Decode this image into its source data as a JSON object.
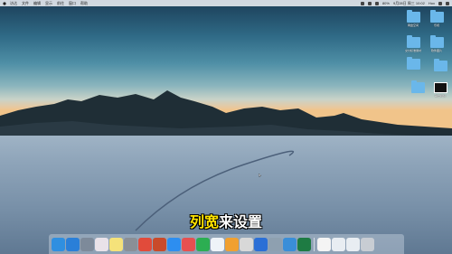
{
  "menubar": {
    "items": [
      "访达",
      "文件",
      "编辑",
      "显示",
      "前往",
      "窗口",
      "帮助"
    ],
    "status": [
      "80%",
      "9月28日 周三 10:02",
      "Hox"
    ]
  },
  "desktop_icons": [
    {
      "label": "网盘空间",
      "type": "folder"
    },
    {
      "label": "乐视",
      "type": "folder"
    },
    {
      "label": "交付标准素材",
      "type": "folder"
    },
    {
      "label": "软件图片",
      "type": "folder"
    },
    {
      "label": "",
      "type": "folder"
    },
    {
      "label": "",
      "type": "folder"
    },
    {
      "label": "",
      "type": "folder"
    },
    {
      "label": "输出视频",
      "type": "video"
    }
  ],
  "subtitle": {
    "highlight": "列宽",
    "rest": "来设置"
  },
  "dock": {
    "items": [
      {
        "name": "finder-icon",
        "color": "#2f8fe0"
      },
      {
        "name": "safari-icon",
        "color": "#2a7fd8"
      },
      {
        "name": "launchpad-icon",
        "color": "#7d8a9a"
      },
      {
        "name": "photos-icon",
        "color": "#e9e2e9"
      },
      {
        "name": "notes-icon",
        "color": "#f5e27a"
      },
      {
        "name": "preferences-icon",
        "color": "#8a8f96"
      },
      {
        "name": "chrome-icon",
        "color": "#e14b3b"
      },
      {
        "name": "app-icon",
        "color": "#c94a2a"
      },
      {
        "name": "appstore-icon",
        "color": "#2d8ef0"
      },
      {
        "name": "app-icon",
        "color": "#e65050"
      },
      {
        "name": "app-icon",
        "color": "#2cae52"
      },
      {
        "name": "icloud-icon",
        "color": "#eef3f8"
      },
      {
        "name": "app-icon",
        "color": "#f0a030"
      },
      {
        "name": "app-icon",
        "color": "#d8d8d8"
      },
      {
        "name": "app-icon",
        "color": "#2b6fd6"
      },
      {
        "name": "app-icon",
        "color": "#8ea0b0"
      },
      {
        "name": "app-icon",
        "color": "#3a8ed8"
      },
      {
        "name": "excel-icon",
        "color": "#1e7b43"
      },
      {
        "name": "document-icon",
        "color": "#f4f4f4"
      },
      {
        "name": "window-icon",
        "color": "#e8edf2"
      },
      {
        "name": "window-icon",
        "color": "#e8edf2"
      },
      {
        "name": "trash-icon",
        "color": "#c8cdd3"
      }
    ]
  }
}
